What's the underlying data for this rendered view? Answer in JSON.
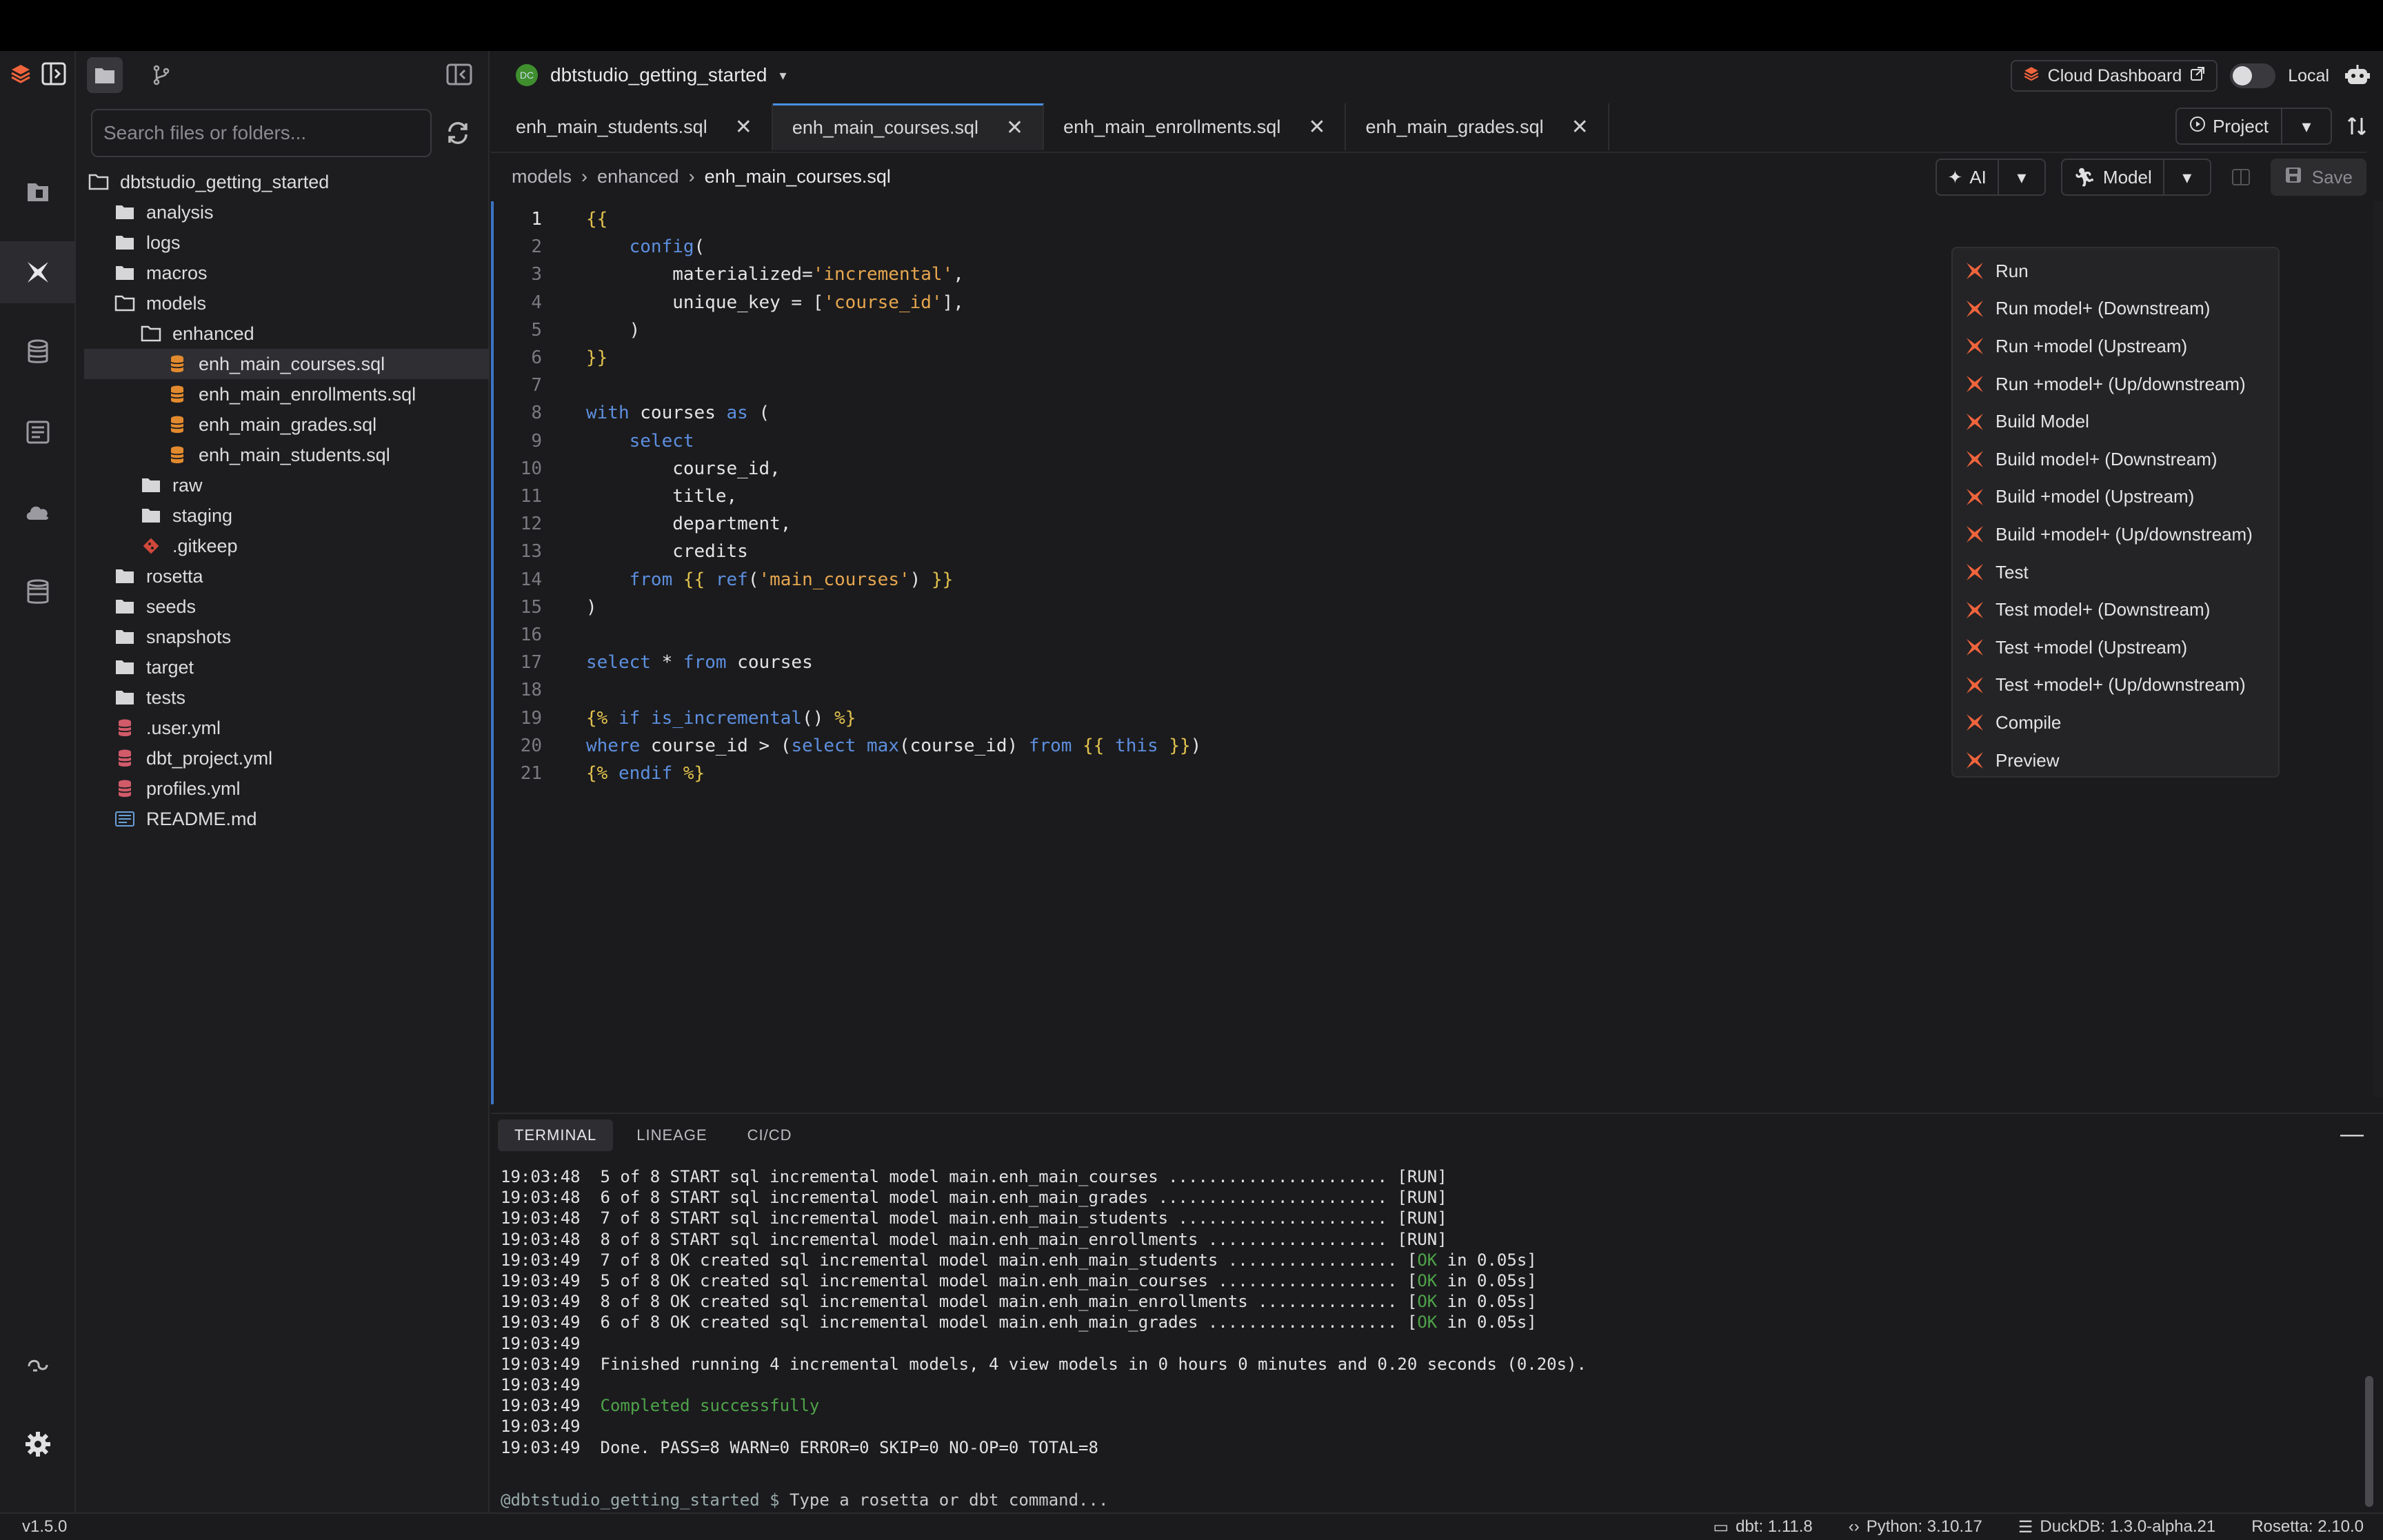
{
  "colors": {
    "accent": "#4a90e2",
    "dbt_orange": "#f0643c",
    "ok_green": "#4fa34a",
    "sql_icon": "#e28a2e"
  },
  "header": {
    "project_name": "dbtstudio_getting_started",
    "project_badge": "DC",
    "cloud_dashboard": "Cloud Dashboard",
    "mode_label": "Local"
  },
  "explorer": {
    "search_placeholder": "Search files or folders...",
    "root": "dbtstudio_getting_started",
    "items": [
      {
        "label": "analysis",
        "depth": 1,
        "icon": "folder-icon"
      },
      {
        "label": "logs",
        "depth": 1,
        "icon": "folder-icon"
      },
      {
        "label": "macros",
        "depth": 1,
        "icon": "folder-icon"
      },
      {
        "label": "models",
        "depth": 1,
        "icon": "folder-open-icon"
      },
      {
        "label": "enhanced",
        "depth": 2,
        "icon": "folder-open-icon"
      },
      {
        "label": "enh_main_courses.sql",
        "depth": 3,
        "icon": "database-file-icon",
        "selected": true
      },
      {
        "label": "enh_main_enrollments.sql",
        "depth": 3,
        "icon": "database-file-icon"
      },
      {
        "label": "enh_main_grades.sql",
        "depth": 3,
        "icon": "database-file-icon"
      },
      {
        "label": "enh_main_students.sql",
        "depth": 3,
        "icon": "database-file-icon"
      },
      {
        "label": "raw",
        "depth": 2,
        "icon": "folder-icon"
      },
      {
        "label": "staging",
        "depth": 2,
        "icon": "folder-icon"
      },
      {
        "label": ".gitkeep",
        "depth": 2,
        "icon": "git-icon"
      },
      {
        "label": "rosetta",
        "depth": 1,
        "icon": "folder-icon"
      },
      {
        "label": "seeds",
        "depth": 1,
        "icon": "folder-icon"
      },
      {
        "label": "snapshots",
        "depth": 1,
        "icon": "folder-icon"
      },
      {
        "label": "target",
        "depth": 1,
        "icon": "folder-icon"
      },
      {
        "label": "tests",
        "depth": 1,
        "icon": "folder-icon"
      },
      {
        "label": ".user.yml",
        "depth": 1,
        "icon": "yaml-file-icon"
      },
      {
        "label": "dbt_project.yml",
        "depth": 1,
        "icon": "yaml-file-icon"
      },
      {
        "label": "profiles.yml",
        "depth": 1,
        "icon": "yaml-file-icon"
      },
      {
        "label": "README.md",
        "depth": 1,
        "icon": "markdown-file-icon"
      }
    ]
  },
  "tabs": [
    {
      "label": "enh_main_students.sql",
      "active": false
    },
    {
      "label": "enh_main_courses.sql",
      "active": true
    },
    {
      "label": "enh_main_enrollments.sql",
      "active": false
    },
    {
      "label": "enh_main_grades.sql",
      "active": false
    }
  ],
  "tab_close": "✕",
  "toolbar": {
    "project_label": "Project",
    "ai_label": "AI",
    "model_label": "Model",
    "save_label": "Save"
  },
  "breadcrumb": [
    "models",
    "enhanced",
    "enh_main_courses.sql"
  ],
  "code_lines": [
    "{{",
    "    config(",
    "        materialized='incremental',",
    "        unique_key = ['course_id'],",
    "    )",
    "}}",
    "",
    "with courses as (",
    "    select",
    "        course_id,",
    "        title,",
    "        department,",
    "        credits",
    "    from {{ ref('main_courses') }}",
    ")",
    "",
    "select * from courses",
    "",
    "{% if is_incremental() %}",
    "where course_id > (select max(course_id) from {{ this }})",
    "{% endif %}"
  ],
  "model_menu": [
    "Run",
    "Run model+ (Downstream)",
    "Run +model (Upstream)",
    "Run +model+ (Up/downstream)",
    "Build Model",
    "Build model+ (Downstream)",
    "Build +model (Upstream)",
    "Build +model+ (Up/downstream)",
    "Test",
    "Test model+ (Downstream)",
    "Test +model (Upstream)",
    "Test +model+ (Up/downstream)",
    "Compile",
    "Preview"
  ],
  "terminal": {
    "tabs": [
      "TERMINAL",
      "LINEAGE",
      "CI/CD"
    ],
    "lines": [
      "19:03:48  5 of 8 START sql incremental model main.enh_main_courses ...................... [RUN]",
      "19:03:48  6 of 8 START sql incremental model main.enh_main_grades ....................... [RUN]",
      "19:03:48  7 of 8 START sql incremental model main.enh_main_students ..................... [RUN]",
      "19:03:48  8 of 8 START sql incremental model main.enh_main_enrollments .................. [RUN]",
      "19:03:49  7 of 8 OK created sql incremental model main.enh_main_students ................. [OK in 0.05s]",
      "19:03:49  5 of 8 OK created sql incremental model main.enh_main_courses .................. [OK in 0.05s]",
      "19:03:49  8 of 8 OK created sql incremental model main.enh_main_enrollments .............. [OK in 0.05s]",
      "19:03:49  6 of 8 OK created sql incremental model main.enh_main_grades ................... [OK in 0.05s]",
      "19:03:49",
      "19:03:49  Finished running 4 incremental models, 4 view models in 0 hours 0 minutes and 0.20 seconds (0.20s).",
      "19:03:49",
      "19:03:49  Completed successfully",
      "19:03:49",
      "19:03:49  Done. PASS=8 WARN=0 ERROR=0 SKIP=0 NO-OP=0 TOTAL=8"
    ],
    "prompt_prefix": "@dbtstudio_getting_started $",
    "prompt_placeholder": "Type a rosetta or dbt command..."
  },
  "status": {
    "version": "v1.5.0",
    "dbt": "dbt: 1.11.8",
    "python": "Python: 3.10.17",
    "duckdb": "DuckDB: 1.3.0-alpha.21",
    "rosetta": "Rosetta: 2.10.0"
  }
}
